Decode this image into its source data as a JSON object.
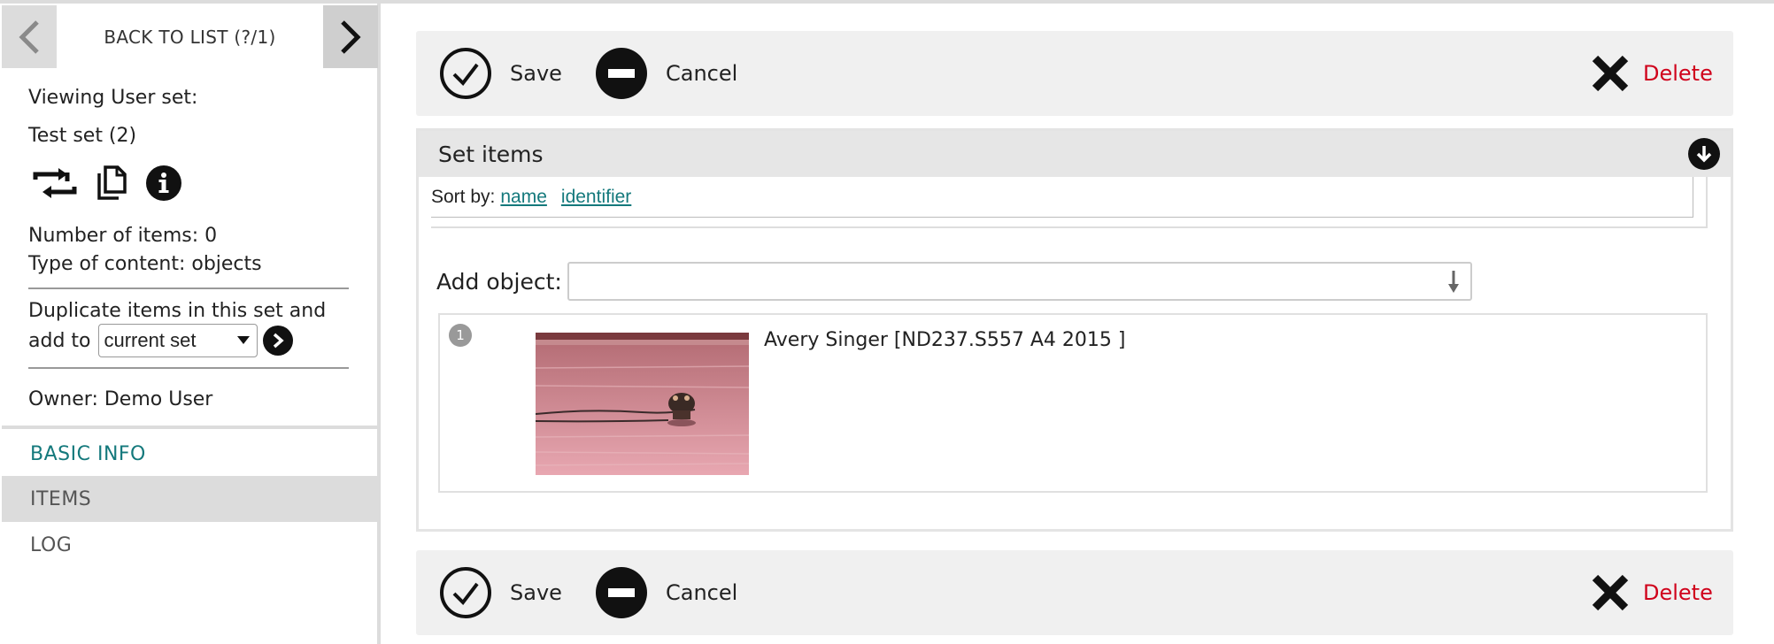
{
  "sidebar": {
    "back_to_list": "BACK TO LIST (?/1)",
    "viewing_label": "Viewing User set:",
    "set_name": "Test set (2)",
    "tool_icons": [
      "swap-arrows-icon",
      "copy-icon",
      "info-icon"
    ],
    "number_of_items": "Number of items: 0",
    "type_of_content": "Type of content: objects",
    "duplicate_line1": "Duplicate items in this set and",
    "duplicate_line2": "add to",
    "duplicate_target": "current set",
    "owner": "Owner: Demo User",
    "nav": {
      "basic_info": "BASIC INFO",
      "items": "ITEMS",
      "log": "LOG"
    }
  },
  "actions": {
    "save": "Save",
    "cancel": "Cancel",
    "delete": "Delete"
  },
  "panel": {
    "title": "Set items",
    "sort_by_label": "Sort by:",
    "sort_options": [
      "name",
      "identifier"
    ],
    "add_object_label": "Add object:",
    "add_object_value": ""
  },
  "items": [
    {
      "number": "1",
      "title": "Avery Singer [ND237.S557 A4 2015 ]"
    }
  ],
  "colors": {
    "accent_teal": "#14797c",
    "delete_red": "#d0021b",
    "panel_bg": "#f0f0f0",
    "nav_active_bg": "#dcdcdc"
  }
}
